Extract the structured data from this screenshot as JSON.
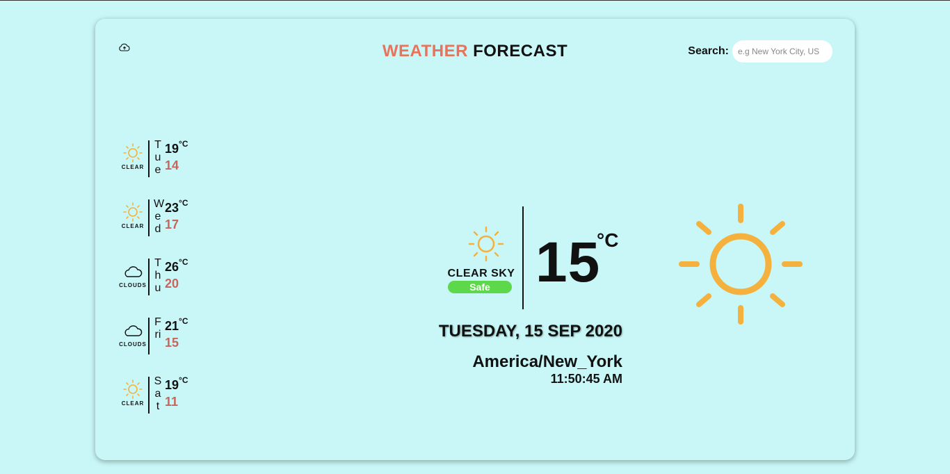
{
  "colors": {
    "background": "#c9f7f7",
    "accent": "#e8735a",
    "sun": "#f4b13d",
    "low_temp": "#c8655a",
    "safe": "#5dd84a"
  },
  "header": {
    "logo_icon": "cloud-upload-icon",
    "title_accent": "WEATHER",
    "title_rest": " FORECAST",
    "search_label": "Search:",
    "search_placeholder": "e.g New York City, US"
  },
  "forecast": [
    {
      "day": "Tue",
      "icon": "sun-icon",
      "condition": "CLEAR",
      "high": "19",
      "unit": "°C",
      "low": "14"
    },
    {
      "day": "Wed",
      "icon": "sun-icon",
      "condition": "CLEAR",
      "high": "23",
      "unit": "°C",
      "low": "17"
    },
    {
      "day": "Thu",
      "icon": "cloud-icon",
      "condition": "CLOUDS",
      "high": "26",
      "unit": "°C",
      "low": "20"
    },
    {
      "day": "Fri",
      "icon": "cloud-icon",
      "condition": "CLOUDS",
      "high": "21",
      "unit": "°C",
      "low": "15"
    },
    {
      "day": "Sat",
      "icon": "sun-icon",
      "condition": "CLEAR",
      "high": "19",
      "unit": "°C",
      "low": "11"
    }
  ],
  "current": {
    "icon": "sun-icon",
    "condition": "CLEAR SKY",
    "safety": "Safe",
    "temp": "15",
    "unit": "°C",
    "date": "TUESDAY, 15 SEP 2020",
    "timezone": "America/New_York",
    "time": "11:50:45 AM",
    "big_icon": "large-sun-icon"
  }
}
